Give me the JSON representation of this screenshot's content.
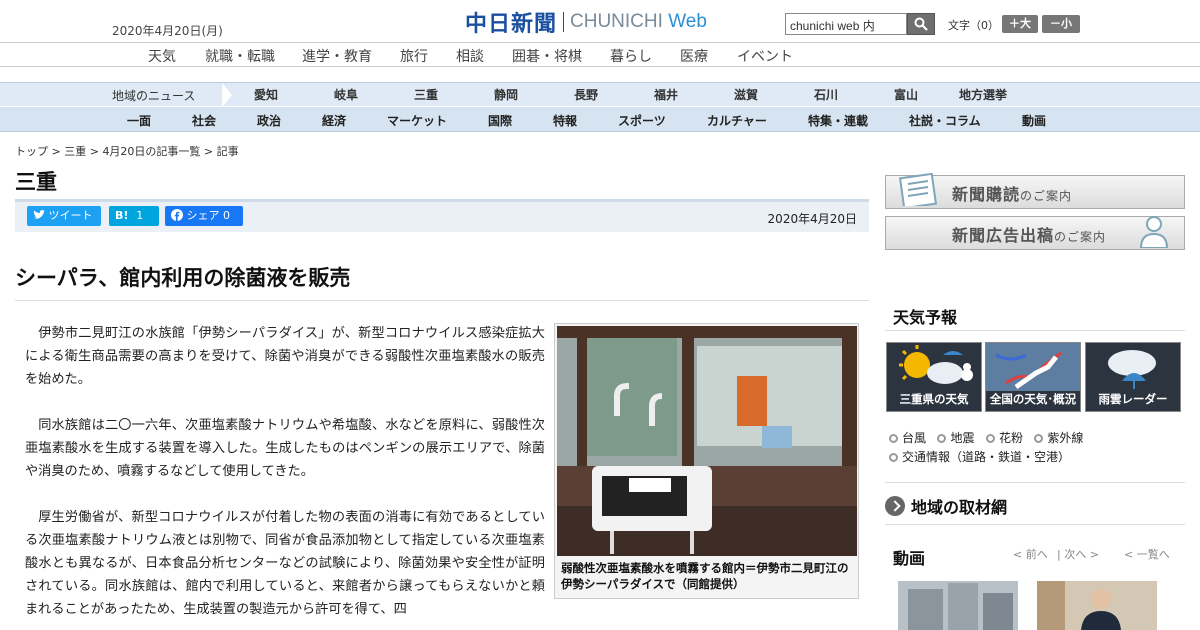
{
  "header": {
    "date": "2020年4月20日(月)",
    "logo_jp": "中日新聞",
    "logo_en": "CHUNICHI",
    "logo_web": "Web",
    "search_value": "chunichi web 内",
    "fontsize_label": "文字（0）",
    "fontsize_up": "＋大",
    "fontsize_down": "－小"
  },
  "nav_primary": [
    "天気",
    "就職・転職",
    "進学・教育",
    "旅行",
    "相談",
    "囲碁・将棋",
    "暮らし",
    "医療",
    "イベント"
  ],
  "nav_region": {
    "label": "地域のニュース",
    "items": [
      "愛知",
      "岐阜",
      "三重",
      "静岡",
      "長野",
      "福井",
      "滋賀",
      "石川",
      "富山",
      "地方選挙"
    ]
  },
  "nav_sections": [
    "一面",
    "社会",
    "政治",
    "経済",
    "マーケット",
    "国際",
    "特報",
    "スポーツ",
    "カルチャー",
    "特集・連載",
    "社説・コラム",
    "動画"
  ],
  "breadcrumb": [
    "トップ",
    "三重",
    "4月20日の記事一覧",
    "記事"
  ],
  "section_title": "三重",
  "share": {
    "tweet": "ツイート",
    "hatena": "B!",
    "hatena_count": "1",
    "facebook": "シェア",
    "facebook_count": "0"
  },
  "article": {
    "date": "2020年4月20日",
    "headline": "シーパラ、館内利用の除菌液を販売",
    "paragraphs": [
      "伊勢市二見町江の水族館「伊勢シーパラダイス」が、新型コロナウイルス感染症拡大による衛生商品需要の高まりを受けて、除菌や消臭ができる弱酸性次亜塩素酸水の販売を始めた。",
      "同水族館は二〇一六年、次亜塩素酸ナトリウムや希塩酸、水などを原料に、弱酸性次亜塩素酸水を生成する装置を導入した。生成したものはペンギンの展示エリアで、除菌や消臭のため、噴霧するなどして使用してきた。",
      "厚生労働省が、新型コロナウイルスが付着した物の表面の消毒に有効であるとしている次亜塩素酸ナトリウム液とは別物で、同省が食品添加物として指定している次亜塩素酸水とも異なるが、日本食品分析センターなどの試験により、除菌効果や安全性が証明されている。同水族館は、館内で利用していると、来館者から譲ってもらえないかと頼まれることがあったため、生成装置の製造元から許可を得て、四"
    ],
    "photo_caption": "弱酸性次亜塩素酸水を噴霧する館内＝伊勢市二見町江の伊勢シーパラダイスで（同館提供）"
  },
  "sidebar": {
    "banner_subscribe": "新聞購読",
    "banner_subscribe_small": "のご案内",
    "banner_ad": "新聞広告出稿",
    "banner_ad_small": "のご案内",
    "weather_title": "天気予報",
    "weather_tiles": [
      "三重県の天気",
      "全国の天気･概況",
      "雨雲レーダー"
    ],
    "weather_links_row1": [
      "台風",
      "地震",
      "花粉",
      "紫外線"
    ],
    "weather_links_row2": [
      "交通情報（道路・鉄道・空港）"
    ],
    "region_network": "地域の取材網",
    "video_title": "動画",
    "video_prev": "前へ",
    "video_next": "次へ",
    "video_list": "一覧へ"
  },
  "colors": {
    "brand_blue": "#1b4fa0",
    "twitter": "#1da1f2",
    "hatena": "#00a4de",
    "facebook": "#1877f2"
  }
}
